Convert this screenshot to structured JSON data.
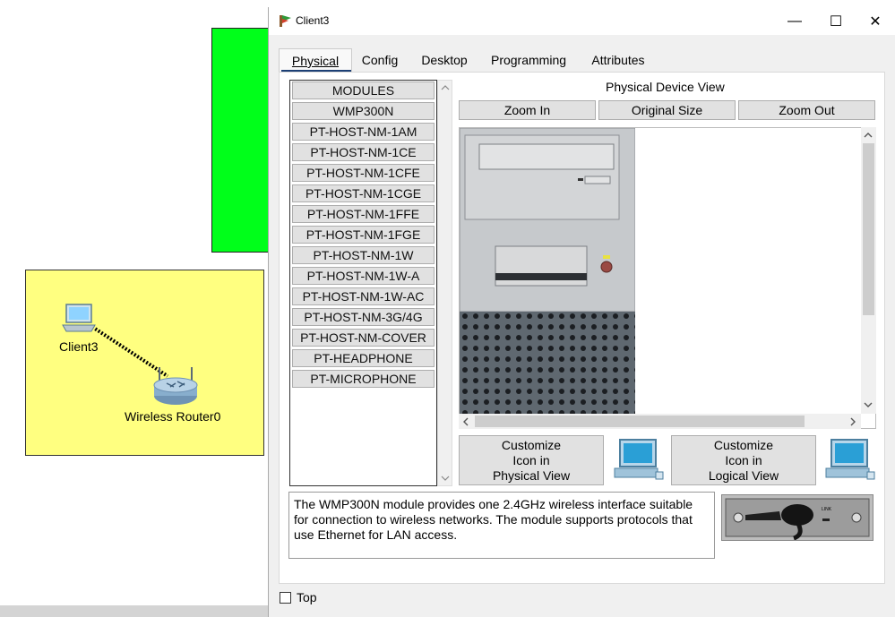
{
  "workspace": {
    "client_label": "Client3",
    "router_label": "Wireless Router0"
  },
  "window": {
    "title": "Client3",
    "minimize_glyph": "—",
    "maximize_glyph": "☐",
    "close_glyph": "✕"
  },
  "tabs": [
    {
      "label": "Physical",
      "active": true
    },
    {
      "label": "Config"
    },
    {
      "label": "Desktop"
    },
    {
      "label": "Programming"
    },
    {
      "label": "Attributes"
    }
  ],
  "modules": {
    "items": [
      "MODULES",
      "WMP300N",
      "PT-HOST-NM-1AM",
      "PT-HOST-NM-1CE",
      "PT-HOST-NM-1CFE",
      "PT-HOST-NM-1CGE",
      "PT-HOST-NM-1FFE",
      "PT-HOST-NM-1FGE",
      "PT-HOST-NM-1W",
      "PT-HOST-NM-1W-A",
      "PT-HOST-NM-1W-AC",
      "PT-HOST-NM-3G/4G",
      "PT-HOST-NM-COVER",
      "PT-HEADPHONE",
      "PT-MICROPHONE"
    ]
  },
  "physical_view": {
    "title": "Physical Device View",
    "zoom_in": "Zoom In",
    "original_size": "Original Size",
    "zoom_out": "Zoom Out"
  },
  "customize": {
    "physical": "Customize\nIcon in\nPhysical View",
    "logical": "Customize\nIcon in\nLogical View"
  },
  "description": "The WMP300N module provides one 2.4GHz wireless interface suitable for connection to wireless networks. The module supports protocols that use Ethernet for LAN access.",
  "module_image_label": "LINK",
  "footer": {
    "top_label": "Top",
    "top_checked": false
  },
  "colors": {
    "green_area": "#00ff1a",
    "yellow_area": "#ffff80",
    "tab_underline": "#1c3f75"
  }
}
